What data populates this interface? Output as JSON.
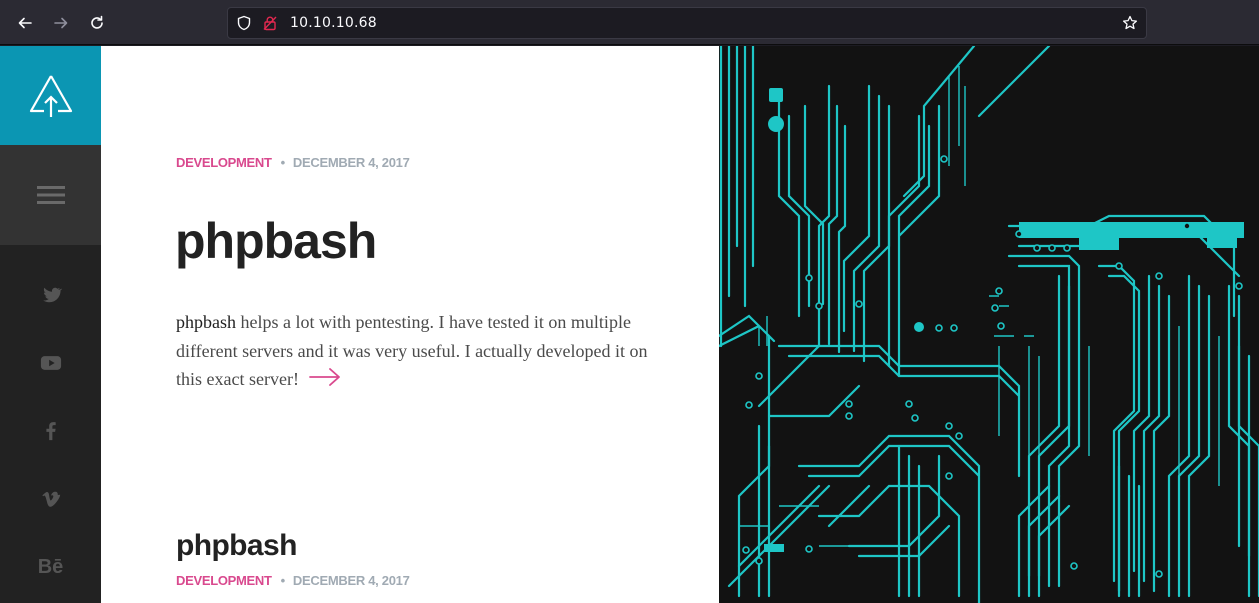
{
  "browser": {
    "url": "10.10.10.68",
    "icons": [
      "back-arrow-icon",
      "forward-arrow-icon",
      "reload-icon",
      "shield-icon",
      "lock-insecure-icon",
      "bookmark-star-icon"
    ]
  },
  "sidebar": {
    "logo_icon": "arrow-up-logo-icon",
    "menu_icon": "hamburger-menu-icon",
    "social": [
      {
        "icon": "twitter-icon"
      },
      {
        "icon": "youtube-icon"
      },
      {
        "icon": "facebook-icon"
      },
      {
        "icon": "vimeo-icon"
      },
      {
        "icon": "behance-icon",
        "label": "Bē"
      }
    ],
    "accent_color": "#0b96b3"
  },
  "post": {
    "category": "DEVELOPMENT",
    "separator": "•",
    "date": "DECEMBER 4, 2017",
    "title": "phpbash",
    "excerpt_lead": "phpbash",
    "excerpt_rest": " helps a lot with pentesting. I have tested it on multiple different servers and it was very useful. I actually developed it on this exact server!",
    "category_color": "#d9498e"
  },
  "next_post": {
    "title": "phpbash",
    "category": "DEVELOPMENT",
    "separator": "•",
    "date": "DECEMBER 4, 2017"
  },
  "hero": {
    "image": "circuit-board-image",
    "trace_color": "#1ec6c6"
  }
}
